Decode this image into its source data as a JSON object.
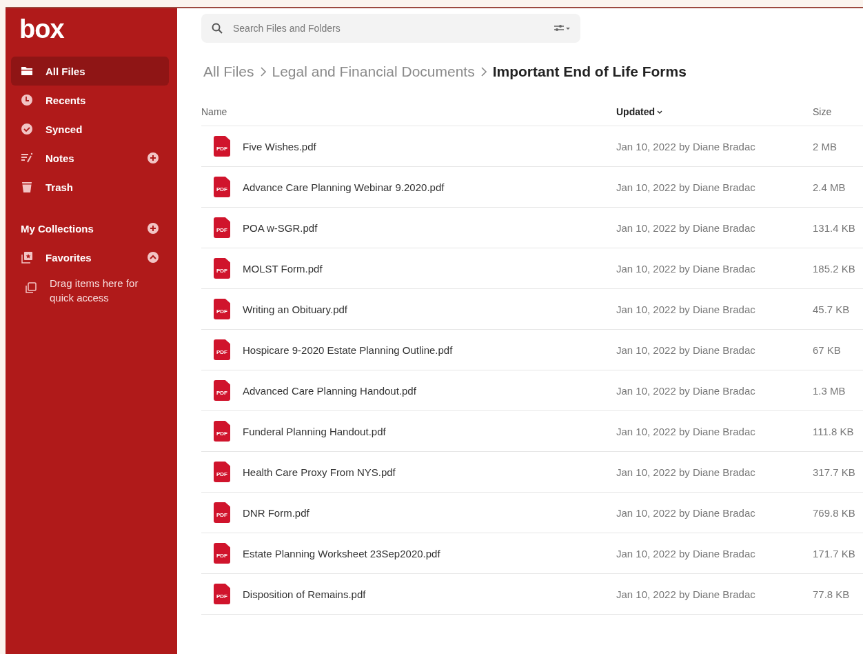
{
  "sidebar": {
    "logo": "box",
    "items": [
      {
        "label": "All Files",
        "kind": "folder",
        "selected": true,
        "add": false
      },
      {
        "label": "Recents",
        "kind": "clock",
        "selected": false,
        "add": false
      },
      {
        "label": "Synced",
        "kind": "check",
        "selected": false,
        "add": false
      },
      {
        "label": "Notes",
        "kind": "notes",
        "selected": false,
        "add": true
      },
      {
        "label": "Trash",
        "kind": "trash",
        "selected": false,
        "add": false
      }
    ],
    "collections": {
      "label": "My Collections"
    },
    "favorites": {
      "label": "Favorites",
      "expanded": true,
      "hint": "Drag items here for quick access"
    }
  },
  "search": {
    "placeholder": "Search Files and Folders"
  },
  "breadcrumbs": [
    "All Files",
    "Legal and Financial Documents",
    "Important End of Life Forms"
  ],
  "table": {
    "columns": [
      {
        "label": "Name",
        "sorted": false
      },
      {
        "label": "Updated",
        "sorted": true
      },
      {
        "label": "Size",
        "sorted": false
      }
    ],
    "rows": [
      {
        "type": "PDF",
        "name": "Five Wishes.pdf",
        "updated": "Jan 10, 2022 by Diane Bradac",
        "size": "2 MB"
      },
      {
        "type": "PDF",
        "name": "Advance Care Planning Webinar 9.2020.pdf",
        "updated": "Jan 10, 2022 by Diane Bradac",
        "size": "2.4 MB"
      },
      {
        "type": "PDF",
        "name": "POA w-SGR.pdf",
        "updated": "Jan 10, 2022 by Diane Bradac",
        "size": "131.4 KB"
      },
      {
        "type": "PDF",
        "name": "MOLST Form.pdf",
        "updated": "Jan 10, 2022 by Diane Bradac",
        "size": "185.2 KB"
      },
      {
        "type": "PDF",
        "name": "Writing an Obituary.pdf",
        "updated": "Jan 10, 2022 by Diane Bradac",
        "size": "45.7 KB"
      },
      {
        "type": "PDF",
        "name": "Hospicare 9-2020 Estate Planning Outline.pdf",
        "updated": "Jan 10, 2022 by Diane Bradac",
        "size": "67 KB"
      },
      {
        "type": "PDF",
        "name": "Advanced Care Planning Handout.pdf",
        "updated": "Jan 10, 2022 by Diane Bradac",
        "size": "1.3 MB"
      },
      {
        "type": "PDF",
        "name": "Funderal Planning Handout.pdf",
        "updated": "Jan 10, 2022 by Diane Bradac",
        "size": "111.8 KB"
      },
      {
        "type": "PDF",
        "name": "Health Care Proxy From NYS.pdf",
        "updated": "Jan 10, 2022 by Diane Bradac",
        "size": "317.7 KB"
      },
      {
        "type": "PDF",
        "name": "DNR Form.pdf",
        "updated": "Jan 10, 2022 by Diane Bradac",
        "size": "769.8 KB"
      },
      {
        "type": "PDF",
        "name": "Estate Planning Worksheet 23Sep2020.pdf",
        "updated": "Jan 10, 2022 by Diane Bradac",
        "size": "171.7 KB"
      },
      {
        "type": "PDF",
        "name": "Disposition of Remains.pdf",
        "updated": "Jan 10, 2022 by Diane Bradac",
        "size": "77.8 KB"
      }
    ]
  }
}
